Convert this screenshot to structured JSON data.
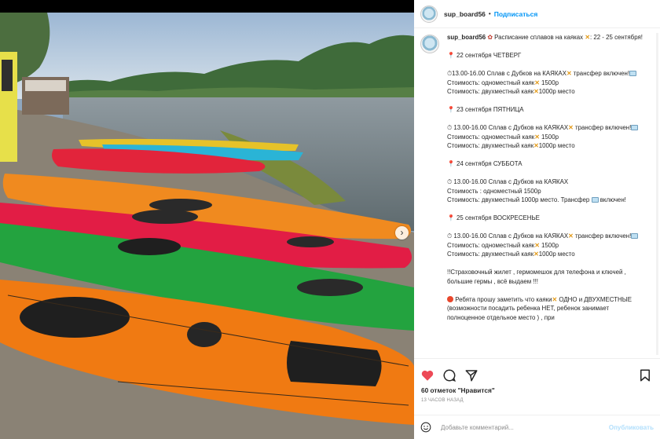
{
  "post": {
    "username": "sup_board56",
    "follow_label": "Подписаться",
    "header_separator": "•"
  },
  "caption": {
    "intro": "Расписание сплавов на каяках",
    "intro_suffix": ": 22 - 25 сентября!",
    "days": [
      {
        "title": "22 сентября ЧЕТВЕРГ",
        "time_line": "13.00-16.00 Сплав с Дубков на КАЯКАХ",
        "transfer_tail": "трансфер включен!",
        "single": "Стоимость: одноместный каяк",
        "single_price": "1500р",
        "double": "Стоимость: двухместный каяк",
        "double_price": "1000р место"
      },
      {
        "title": "23 сентября ПЯТНИЦА",
        "time_line": "13.00-16.00 Сплав с Дубков на КАЯКАХ",
        "transfer_tail": "трансфер включен!",
        "single": "Стоимость: одноместный каяк",
        "single_price": "1500р",
        "double": "Стоимость: двухместный каяк",
        "double_price": "1000р место"
      },
      {
        "title": "24 сентября СУББОТА",
        "time_line": "13.00-16.00 Сплав с Дубков на КАЯКАХ",
        "single_line": "Стоимость : одноместный 1500р",
        "double_line": "Стоимость: двухместный 1000р место. Трансфер",
        "double_tail": "включен!"
      },
      {
        "title": "25 сентября ВОСКРЕСЕНЬЕ",
        "time_line": "13.00-16.00 Сплав с Дубков на КАЯКАХ",
        "transfer_tail": "трансфер включен!",
        "single": "Стоимость: одноместный каяк",
        "single_price": "1500р",
        "double": "Стоимость: двухместный каяк",
        "double_price": "1000р место"
      }
    ],
    "insurance": "!!Страховочный жилет , гермомешок для телефона и ключей , большие гермы , всё выдаем !!!",
    "note_start": "Ребята прошу заметить что каяки",
    "note_rest": "ОДНО и ДВУХМЕСТНЫЕ (возможности посадить ребенка НЕТ, ребенок занимает полноценное отдельное место ) , при"
  },
  "stats": {
    "likes": "60 отметок \"Нравится\"",
    "time": "13 ЧАСОВ НАЗАД"
  },
  "comment": {
    "placeholder": "Добавьте комментарий...",
    "publish_label": "Опубликовать"
  },
  "icons": {
    "like": "heart-filled-icon",
    "comment": "comment-bubble-icon",
    "share": "paper-plane-icon",
    "save": "bookmark-icon",
    "emoji": "smiley-icon",
    "carousel_next": "chevron-right-icon"
  },
  "colors": {
    "link_blue": "#0095f6",
    "like_red": "#ed4956",
    "publish_disabled": "#b2dffc"
  }
}
